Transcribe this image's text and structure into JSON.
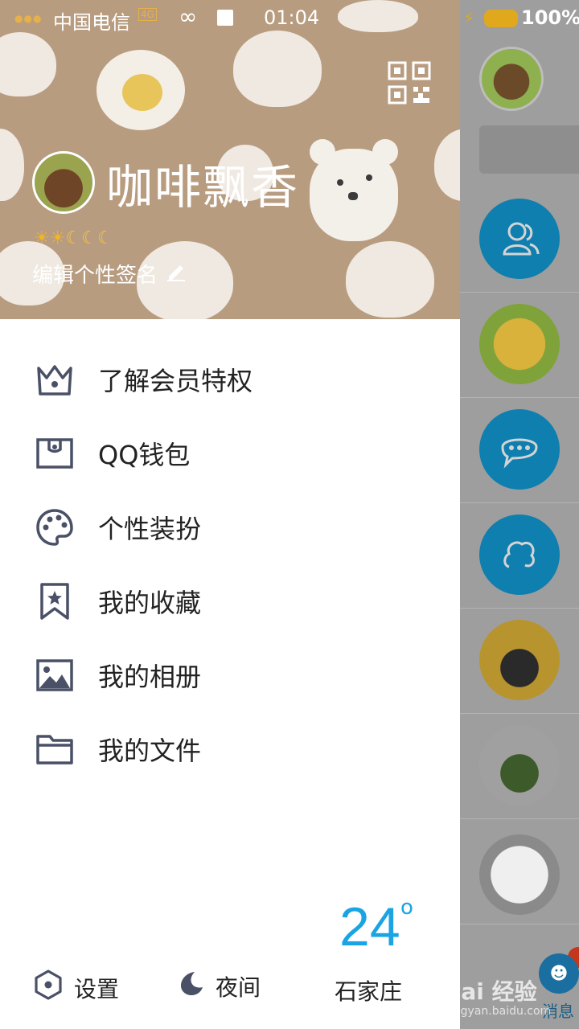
{
  "status_bar": {
    "signal_text": "4G",
    "carrier": "中国电信",
    "net_badge": "4G",
    "time": "01:04",
    "battery_pct": "100%"
  },
  "header": {
    "nickname": "咖啡飘香",
    "signature": "编辑个性签名"
  },
  "menu": [
    {
      "label": "了解会员特权",
      "icon": "crown-icon"
    },
    {
      "label": "QQ钱包",
      "icon": "wallet-icon"
    },
    {
      "label": "个性装扮",
      "icon": "palette-icon"
    },
    {
      "label": "我的收藏",
      "icon": "bookmark-star-icon"
    },
    {
      "label": "我的相册",
      "icon": "photo-icon"
    },
    {
      "label": "我的文件",
      "icon": "folder-icon"
    }
  ],
  "bottom": {
    "settings_label": "设置",
    "night_label": "夜间"
  },
  "weather": {
    "temp": "24",
    "degree": "o",
    "city": "石家庄"
  },
  "background_app": {
    "message_tab_label": "消息"
  },
  "watermark": {
    "text": "Bai 经验",
    "sub": "jingyan.baidu.com"
  },
  "colors": {
    "header_bg": "#b89c80",
    "accent_blue": "#1aa4e4",
    "icon_gray": "#4a5066"
  }
}
